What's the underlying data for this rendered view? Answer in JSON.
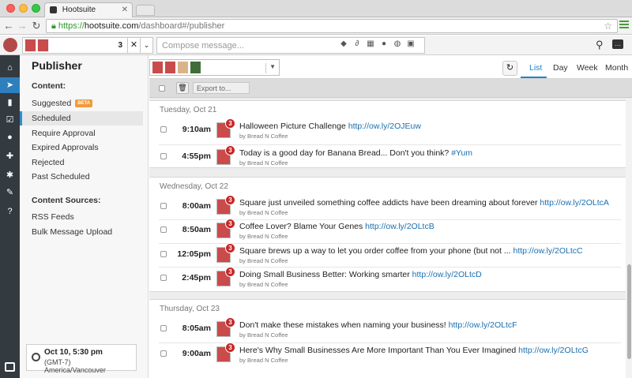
{
  "browser": {
    "tab_title": "Hootsuite",
    "url_scheme": "https://",
    "url_host": "hootsuite.com",
    "url_path": "/dashboard#/publisher"
  },
  "toolbar": {
    "profile_count": "3",
    "compose_placeholder": "Compose message..."
  },
  "sidebar": {
    "title": "Publisher",
    "content_heading": "Content:",
    "content_items": [
      {
        "label": "Suggested",
        "badge": "BETA"
      },
      {
        "label": "Scheduled"
      },
      {
        "label": "Require Approval"
      },
      {
        "label": "Expired Approvals"
      },
      {
        "label": "Rejected"
      },
      {
        "label": "Past Scheduled"
      }
    ],
    "sources_heading": "Content Sources:",
    "source_items": [
      {
        "label": "RSS Feeds"
      },
      {
        "label": "Bulk Message Upload"
      }
    ],
    "timezone": {
      "time": "Oct 10, 5:30 pm",
      "zone": "(GMT-7) America/Vancouver"
    }
  },
  "views": [
    "List",
    "Day",
    "Week",
    "Month"
  ],
  "active_view": "List",
  "actions": {
    "export_label": "Export to..."
  },
  "days": [
    {
      "label": "Tuesday, Oct 21",
      "posts": [
        {
          "time": "9:10am",
          "text": "Halloween Picture Challenge ",
          "link": "http://ow.ly/2OJEuw",
          "by": "by Bread N Coffee",
          "badge": "3"
        },
        {
          "time": "4:55pm",
          "text": "Today is a good day for Banana Bread... Don't you think? ",
          "link": "#Yum",
          "by": "by Bread N Coffee",
          "badge": "3"
        }
      ]
    },
    {
      "label": "Wednesday, Oct 22",
      "posts": [
        {
          "time": "8:00am",
          "text": "Square just unveiled something coffee addicts have been dreaming about forever ",
          "link": "http://ow.ly/2OLtcA",
          "by": "by Bread N Coffee",
          "badge": "3"
        },
        {
          "time": "8:50am",
          "text": "Coffee Lover? Blame Your Genes ",
          "link": "http://ow.ly/2OLtcB",
          "by": "by Bread N Coffee",
          "badge": "3"
        },
        {
          "time": "12:05pm",
          "text": "Square brews up a way to let you order coffee from your phone (but not ... ",
          "link": "http://ow.ly/2OLtcC",
          "by": "by Bread N Coffee",
          "badge": "3"
        },
        {
          "time": "2:45pm",
          "text": "Doing Small Business Better: Working smarter ",
          "link": "http://ow.ly/2OLtcD",
          "by": "by Bread N Coffee",
          "badge": "3"
        }
      ]
    },
    {
      "label": "Thursday, Oct 23",
      "posts": [
        {
          "time": "8:05am",
          "text": "Don't make these mistakes when naming your business! ",
          "link": "http://ow.ly/2OLtcF",
          "by": "by Bread N Coffee",
          "badge": "3"
        },
        {
          "time": "9:00am",
          "text": "Here's Why Small Businesses Are More Important Than You Ever Imagined ",
          "link": "http://ow.ly/2OLtcG",
          "by": "by Bread N Coffee",
          "badge": "3"
        }
      ]
    }
  ],
  "colors": {
    "accent": "#1a86c8",
    "rail": "#333a40",
    "badge": "#c42828",
    "beta": "#f29a3a"
  },
  "icons": [
    "home-icon",
    "paper-plane-icon",
    "analytics-icon",
    "checklist-icon",
    "user-icon",
    "puzzle-icon",
    "gear-icon",
    "wrench-icon",
    "help-icon",
    "logout-icon",
    "search-icon",
    "chat-icon",
    "tag-icon",
    "attachment-icon",
    "calendar-icon",
    "location-icon",
    "globe-icon",
    "lock-icon",
    "refresh-icon",
    "trash-icon",
    "clock-icon"
  ]
}
